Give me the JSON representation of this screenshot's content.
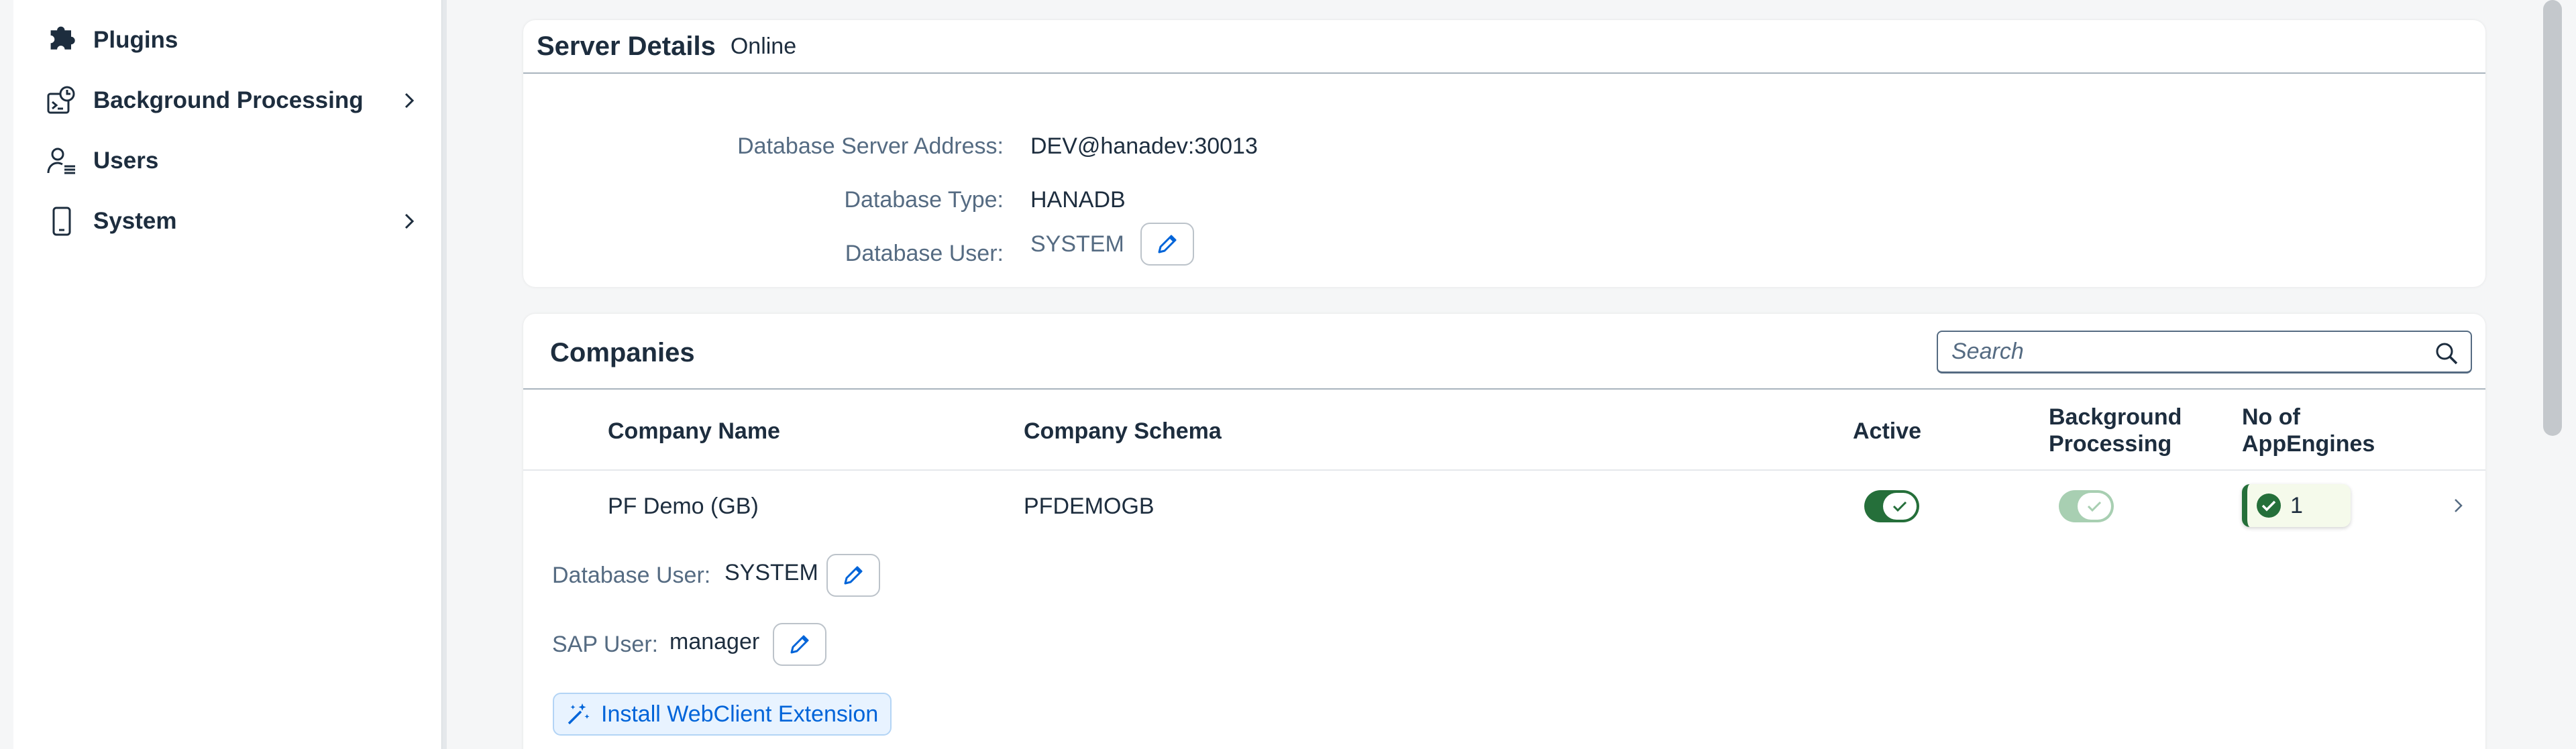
{
  "sidebar": {
    "items": [
      {
        "label": "Plugins",
        "icon": "puzzle-icon"
      },
      {
        "label": "Background Processing",
        "icon": "background-processing-icon",
        "has_children": true
      },
      {
        "label": "Users",
        "icon": "users-icon"
      },
      {
        "label": "System",
        "icon": "device-icon",
        "has_children": true
      }
    ]
  },
  "server_details": {
    "title": "Server Details",
    "status": "Online",
    "fields": {
      "address_label": "Database Server Address:",
      "address_value": "DEV@hanadev:30013",
      "type_label": "Database Type:",
      "type_value": "HANADB",
      "user_label": "Database User:",
      "user_value": "SYSTEM"
    }
  },
  "companies": {
    "title": "Companies",
    "search_placeholder": "Search",
    "columns": {
      "company_name": "Company Name",
      "company_schema": "Company Schema",
      "active": "Active",
      "background_processing_line1": "Background",
      "background_processing_line2": "Processing",
      "appengines_line1": "No of",
      "appengines_line2": "AppEngines"
    },
    "rows": [
      {
        "company_name": "PF Demo (GB)",
        "company_schema": "PFDEMOGB",
        "active": true,
        "background_processing": true,
        "appengines": "1",
        "database_user_label": "Database User:",
        "database_user": "SYSTEM",
        "sap_user_label": "SAP User:",
        "sap_user": "manager",
        "install_label": "Install WebClient Extension"
      }
    ]
  },
  "colors": {
    "accent": "#0064d9",
    "success": "#256f3a",
    "text": "#1d2d3e",
    "label": "#556b82"
  }
}
